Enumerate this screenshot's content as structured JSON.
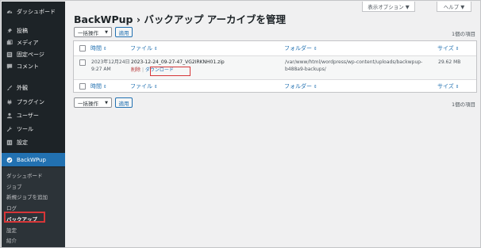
{
  "sidebar": {
    "items": [
      {
        "label": "ダッシュボード",
        "icon": "dashboard-icon"
      },
      {
        "label": "投稿",
        "icon": "pin-icon"
      },
      {
        "label": "メディア",
        "icon": "media-icon"
      },
      {
        "label": "固定ページ",
        "icon": "page-icon"
      },
      {
        "label": "コメント",
        "icon": "comment-icon"
      },
      {
        "label": "外観",
        "icon": "brush-icon"
      },
      {
        "label": "プラグイン",
        "icon": "plugin-icon"
      },
      {
        "label": "ユーザー",
        "icon": "user-icon"
      },
      {
        "label": "ツール",
        "icon": "wrench-icon"
      },
      {
        "label": "設定",
        "icon": "settings-icon"
      },
      {
        "label": "BackWPup",
        "icon": "backwpup-icon"
      }
    ],
    "submenu": [
      "ダッシュボード",
      "ジョブ",
      "新規ジョブを追加",
      "ログ",
      "バックアップ",
      "設定",
      "紹介"
    ],
    "active_color": "#2271b1",
    "highlight_color": "#d63638"
  },
  "header": {
    "title": "BackWPup › バックアップ アーカイブを管理",
    "screen_options": "表示オプション ▼",
    "help": "ヘルプ ▼"
  },
  "bulk": {
    "select_label": "一括操作",
    "apply_label": "適用",
    "count": "1個の項目"
  },
  "table": {
    "headers": {
      "time": "時間",
      "file": "ファイル",
      "folder": "フォルダー",
      "size": "サイズ"
    },
    "row": {
      "time_date": "2023年12月24",
      "time_day": "日",
      "time_clock": "9:27 AM",
      "filename": "2023-12-24_09-27-47_VG2IRKNH01.zip",
      "delete": "削除",
      "separator": "|",
      "download": "ダウンロード",
      "folder_line1": "/var/www/html/wordpress/wp-content/uploads/backwpup-",
      "folder_line2": "b488a9-backups/",
      "size": "29.62 MB"
    }
  }
}
